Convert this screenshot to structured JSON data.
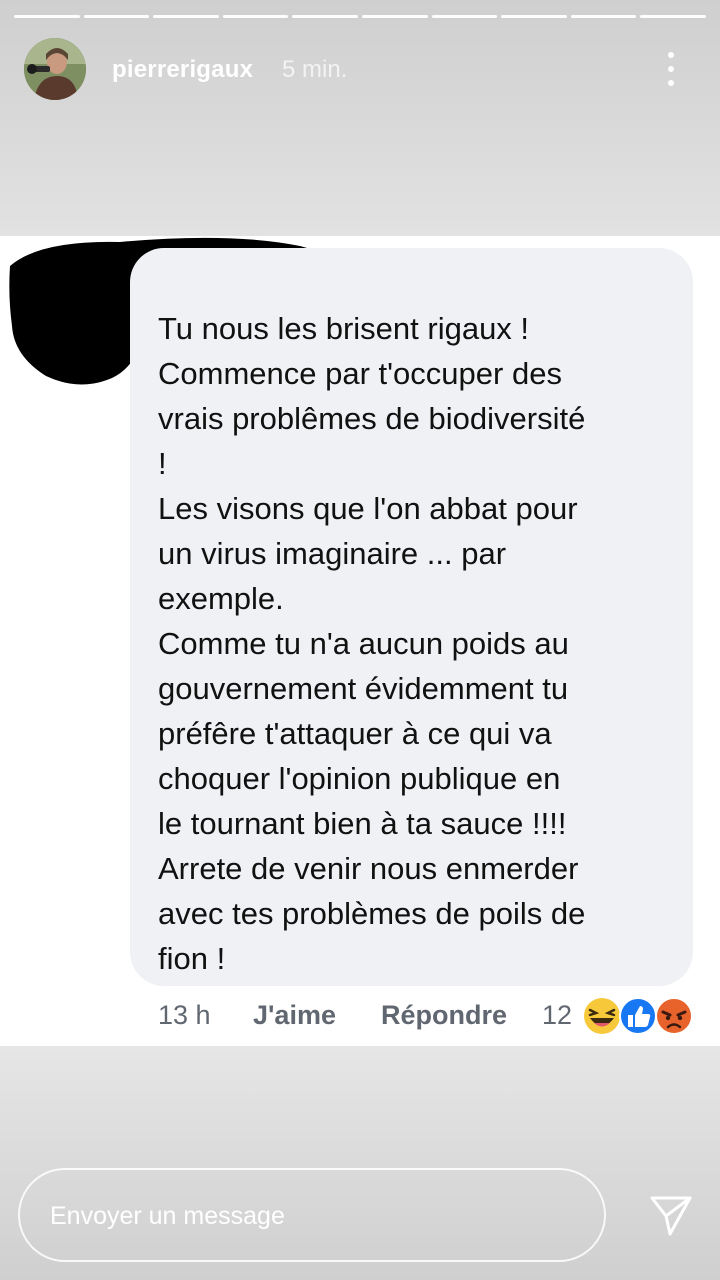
{
  "story": {
    "username": "pierrerigaux",
    "time": "5 min.",
    "more_icon": "more-vertical-icon",
    "segments_total": 10,
    "segments_viewed": 10
  },
  "comment": {
    "text": "Tu nous les brisent rigaux !\nCommence par t'occuper des\nvrais problêmes de biodiversité\n!\nLes visons que l'on abbat pour\nun virus imaginaire ... par\nexemple.\nComme tu n'a aucun poids au\ngouvernement évidemment tu\npréfêre t'attaquer à ce qui va\nchoquer l'opinion publique en\nle tournant bien à ta sauce !!!!\nArrete de venir nous enmerder\navec tes problèmes de poils de\nfion !",
    "time": "13 h",
    "like_label": "J'aime",
    "reply_label": "Répondre",
    "reaction_count": "12",
    "reactions": [
      "haha",
      "like",
      "angry"
    ]
  },
  "message_bar": {
    "placeholder": "Envoyer un message",
    "send_icon": "send-icon"
  },
  "colors": {
    "bubble": "#eff1f4",
    "action_text": "#606770",
    "like_blue": "#1877f2",
    "haha_yellow": "#f7c93a",
    "angry_orange": "#e8632b"
  }
}
